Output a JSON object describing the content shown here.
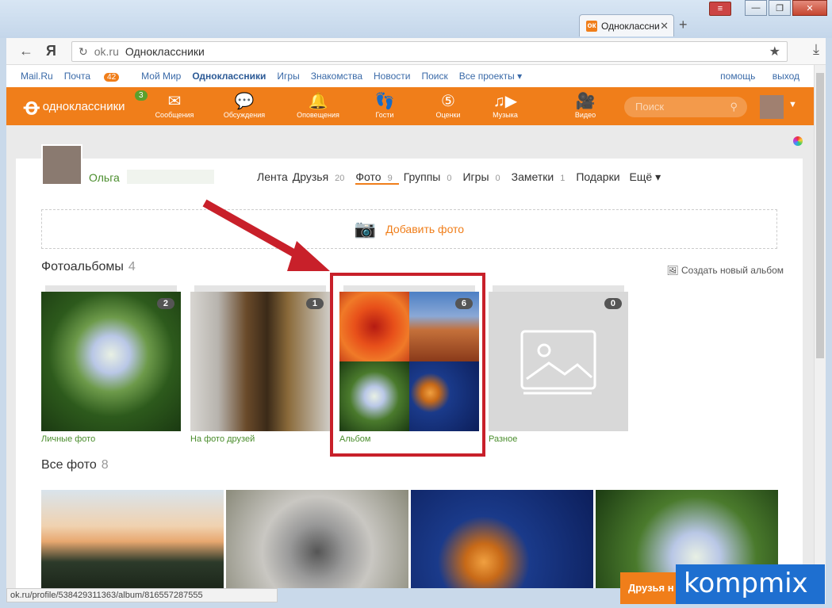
{
  "browser": {
    "tab_title": "Одноклассни",
    "tab_favicon": "ok-icon",
    "url_domain": "ok.ru",
    "url_title": "Одноклассники",
    "status_url": "ok.ru/profile/538429311363/album/816557287555"
  },
  "toplinks": {
    "mailru": "Mail.Ru",
    "pochta": "Почта",
    "pochta_badge": "42",
    "moi_mir": "Мой Мир",
    "odnoklassniki": "Одноклассники",
    "igry": "Игры",
    "znakomstva": "Знакомства",
    "novosti": "Новости",
    "poisk": "Поиск",
    "vse_proekty": "Все проекты ▾",
    "pomosh": "помощь",
    "vyhod": "выход"
  },
  "header": {
    "logo_text": "одноклассники",
    "logo_badge": "3",
    "nav": [
      {
        "label": "Сообщения",
        "icon": "envelope-icon"
      },
      {
        "label": "Обсуждения",
        "icon": "chat-icon"
      },
      {
        "label": "Оповещения",
        "icon": "bell-icon"
      },
      {
        "label": "Гости",
        "icon": "footprints-icon"
      },
      {
        "label": "Оценки",
        "icon": "rating-icon"
      },
      {
        "label": "Музыка",
        "icon": "music-icon"
      },
      {
        "label": "Видео",
        "icon": "video-icon"
      }
    ],
    "search_placeholder": "Поиск"
  },
  "profile": {
    "name": "Ольга",
    "tabs": [
      {
        "label": "Лента",
        "count": ""
      },
      {
        "label": "Друзья",
        "count": "20"
      },
      {
        "label": "Фото",
        "count": "9"
      },
      {
        "label": "Группы",
        "count": "0"
      },
      {
        "label": "Игры",
        "count": "0"
      },
      {
        "label": "Заметки",
        "count": "1"
      },
      {
        "label": "Подарки",
        "count": ""
      },
      {
        "label": "Ещё ▾",
        "count": ""
      }
    ]
  },
  "photos": {
    "add_photo": "Добавить фото",
    "albums_title": "Фотоальбомы",
    "albums_count": "4",
    "create_album": "Создать новый альбом",
    "albums": [
      {
        "label": "Личные фото",
        "count": "2"
      },
      {
        "label": "На фото друзей",
        "count": "1"
      },
      {
        "label": "Альбом",
        "count": "6"
      },
      {
        "label": "Разное",
        "count": "0"
      }
    ],
    "all_title": "Все фото",
    "all_count": "8"
  },
  "overlay": {
    "friends_button": "Друзья н",
    "watermark": "kompmix"
  }
}
